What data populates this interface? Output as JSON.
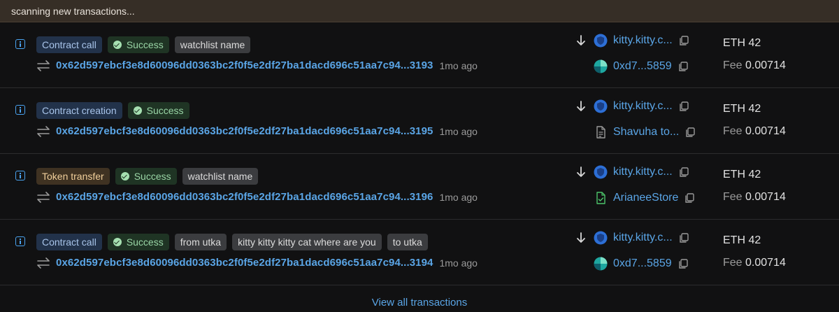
{
  "scan_status": "scanning new transactions...",
  "transactions": [
    {
      "type": "Contract call",
      "type_kind": "contract",
      "status": "Success",
      "tags": [
        "watchlist name"
      ],
      "hash": "0x62d597ebcf3e8d60096dd0363bc2f0f5e2df27ba1dacd696c51aa7c94...3193",
      "age": "1mo ago",
      "from": "kitty.kitty.c...",
      "to": "0xd7...5859",
      "to_icon": "identicon-icon",
      "amount_label": "ETH 42",
      "fee_label": "Fee",
      "fee_value": "0.00714"
    },
    {
      "type": "Contract creation",
      "type_kind": "contract",
      "status": "Success",
      "tags": [],
      "hash": "0x62d597ebcf3e8d60096dd0363bc2f0f5e2df27ba1dacd696c51aa7c94...3195",
      "age": "1mo ago",
      "from": "kitty.kitty.c...",
      "to": "Shavuha to...",
      "to_icon": "document-icon",
      "amount_label": "ETH 42",
      "fee_label": "Fee",
      "fee_value": "0.00714"
    },
    {
      "type": "Token transfer",
      "type_kind": "token",
      "status": "Success",
      "tags": [
        "watchlist name"
      ],
      "hash": "0x62d597ebcf3e8d60096dd0363bc2f0f5e2df27ba1dacd696c51aa7c94...3196",
      "age": "1mo ago",
      "from": "kitty.kitty.c...",
      "to": "ArianeeStore",
      "to_icon": "verified-contract-icon",
      "amount_label": "ETH 42",
      "fee_label": "Fee",
      "fee_value": "0.00714"
    },
    {
      "type": "Contract call",
      "type_kind": "contract",
      "status": "Success",
      "tags": [
        "from utka",
        "kitty kitty kitty cat where are you",
        "to utka"
      ],
      "hash": "0x62d597ebcf3e8d60096dd0363bc2f0f5e2df27ba1dacd696c51aa7c94...3194",
      "age": "1mo ago",
      "from": "kitty.kitty.c...",
      "to": "0xd7...5859",
      "to_icon": "identicon-icon",
      "amount_label": "ETH 42",
      "fee_label": "Fee",
      "fee_value": "0.00714"
    }
  ],
  "view_all_label": "View all transactions",
  "colors": {
    "link": "#5aa5e6",
    "success": "#9ad6a6",
    "background": "#111112"
  }
}
